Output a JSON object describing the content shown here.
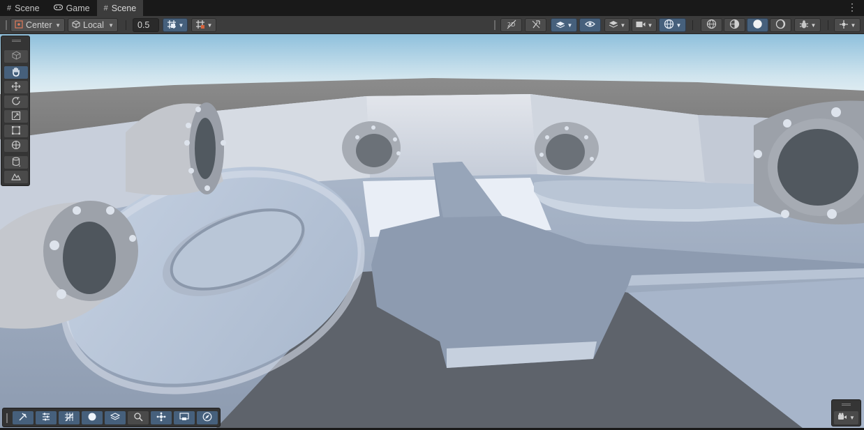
{
  "tabs": [
    {
      "label": "Scene",
      "icon": "hash-icon",
      "active": false
    },
    {
      "label": "Game",
      "icon": "gamepad-icon",
      "active": false
    },
    {
      "label": "Scene",
      "icon": "hash-icon",
      "active": true
    }
  ],
  "toolbar": {
    "pivot_mode": "Center",
    "pivot_rotation": "Local",
    "snap_increment": "0.5"
  },
  "colors": {
    "active_blue": "#46607c",
    "panel": "#3c3c3c",
    "chrome": "#191919"
  }
}
